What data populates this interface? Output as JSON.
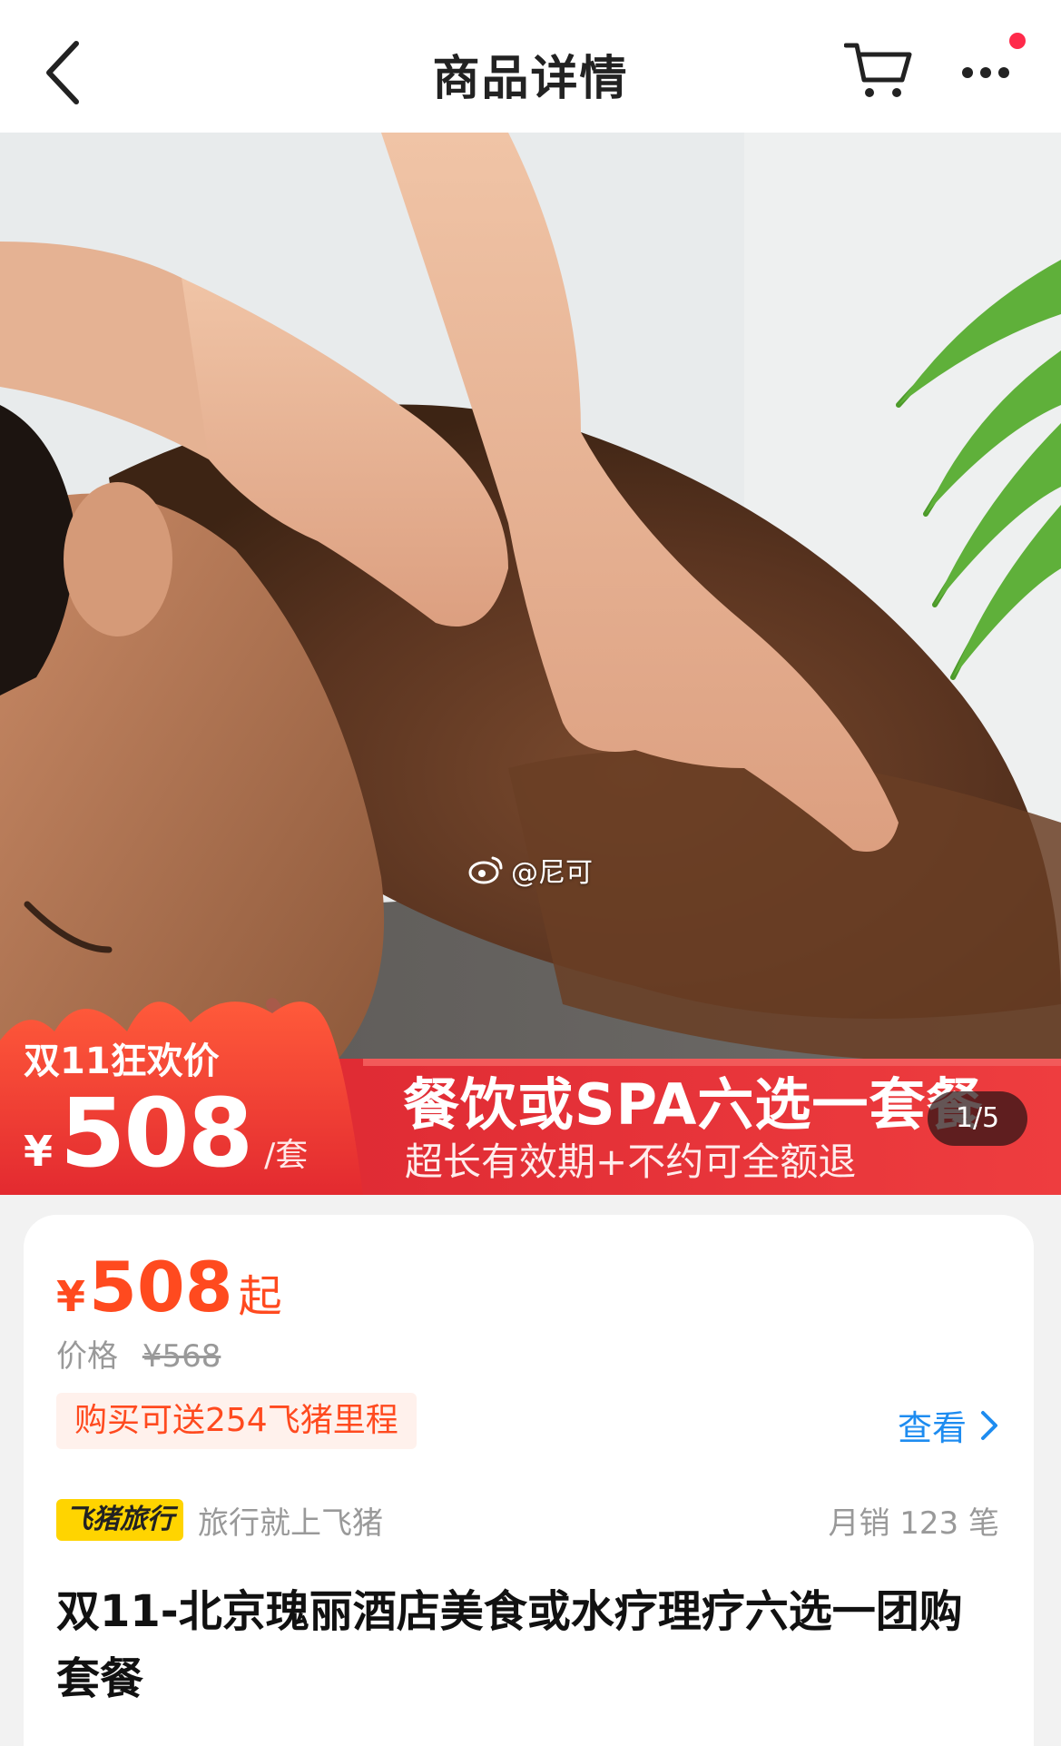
{
  "nav": {
    "title": "商品详情",
    "back_icon": "chevron-left-icon",
    "cart_icon": "cart-icon",
    "more_icon": "more-dots-icon",
    "badge_color": "#ff2a4a"
  },
  "hero": {
    "watermark": "@尼可",
    "promo": {
      "label": "双11狂欢价",
      "currency": "¥",
      "price": "508",
      "unit": "/套",
      "headline": "餐饮或SPA六选一套餐",
      "subline": "超长有效期+不约可全额退"
    },
    "page_indicator": "1/5"
  },
  "product": {
    "currency": "¥",
    "price": "508",
    "price_suffix": "起",
    "orig_label": "价格",
    "orig_price": "¥568",
    "mileage_tag": "购买可送254飞猪里程",
    "view_label": "查看",
    "brand_logo": "飞猪旅行",
    "brand_slogan": "旅行就上飞猪",
    "monthly_sales": "月销 123 笔",
    "title": "双11-北京瑰丽酒店美食或水疗理疗六选一团购套餐"
  },
  "colors": {
    "accent": "#ff4a1f",
    "link": "#1e8cf0",
    "promo_red": "#e8343a",
    "brand_yellow": "#ffd400"
  }
}
